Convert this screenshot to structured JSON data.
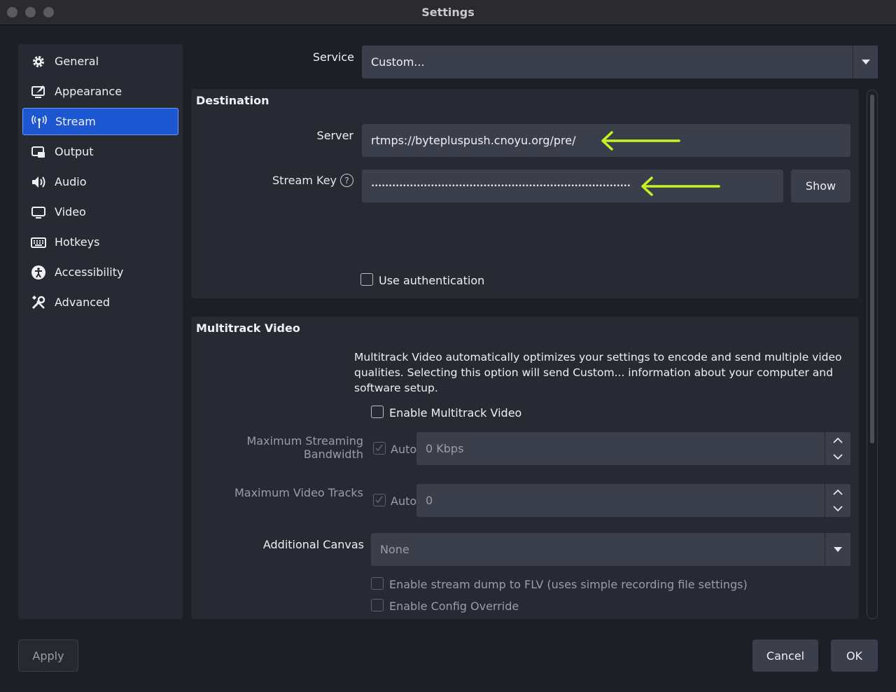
{
  "window": {
    "title": "Settings"
  },
  "sidebar": {
    "items": [
      {
        "label": "General",
        "icon": "gear-icon"
      },
      {
        "label": "Appearance",
        "icon": "appearance-icon"
      },
      {
        "label": "Stream",
        "icon": "antenna-icon"
      },
      {
        "label": "Output",
        "icon": "output-icon"
      },
      {
        "label": "Audio",
        "icon": "speaker-icon"
      },
      {
        "label": "Video",
        "icon": "monitor-icon"
      },
      {
        "label": "Hotkeys",
        "icon": "keyboard-icon"
      },
      {
        "label": "Accessibility",
        "icon": "accessibility-icon"
      },
      {
        "label": "Advanced",
        "icon": "tools-icon"
      }
    ],
    "active": "Stream"
  },
  "service": {
    "label": "Service",
    "value": "Custom..."
  },
  "destination": {
    "title": "Destination",
    "server_label": "Server",
    "server_value": "rtmps://bytepluspush.cnoyu.org/pre/",
    "key_label": "Stream Key",
    "key_value": "••••••••••••••••••••••••••••••••••••••••••••••••••••••••••••••••••••••••••",
    "show_button": "Show",
    "use_auth": "Use authentication"
  },
  "multitrack": {
    "title": "Multitrack Video",
    "description": "Multitrack Video automatically optimizes your settings to encode and send multiple video qualities. Selecting this option will send Custom... information about your computer and software setup.",
    "enable_label": "Enable Multitrack Video",
    "bandwidth_label": "Maximum Streaming Bandwidth",
    "bandwidth_auto": "Auto",
    "bandwidth_value": "0 Kbps",
    "tracks_label": "Maximum Video Tracks",
    "tracks_auto": "Auto",
    "tracks_value": "0",
    "canvas_label": "Additional Canvas",
    "canvas_value": "None",
    "dump_label": "Enable stream dump to FLV (uses simple recording file settings)",
    "override_label": "Enable Config Override"
  },
  "footer": {
    "apply": "Apply",
    "cancel": "Cancel",
    "ok": "OK"
  },
  "colors": {
    "accent": "#1d56d1",
    "annotation_arrow": "#c6f324"
  }
}
